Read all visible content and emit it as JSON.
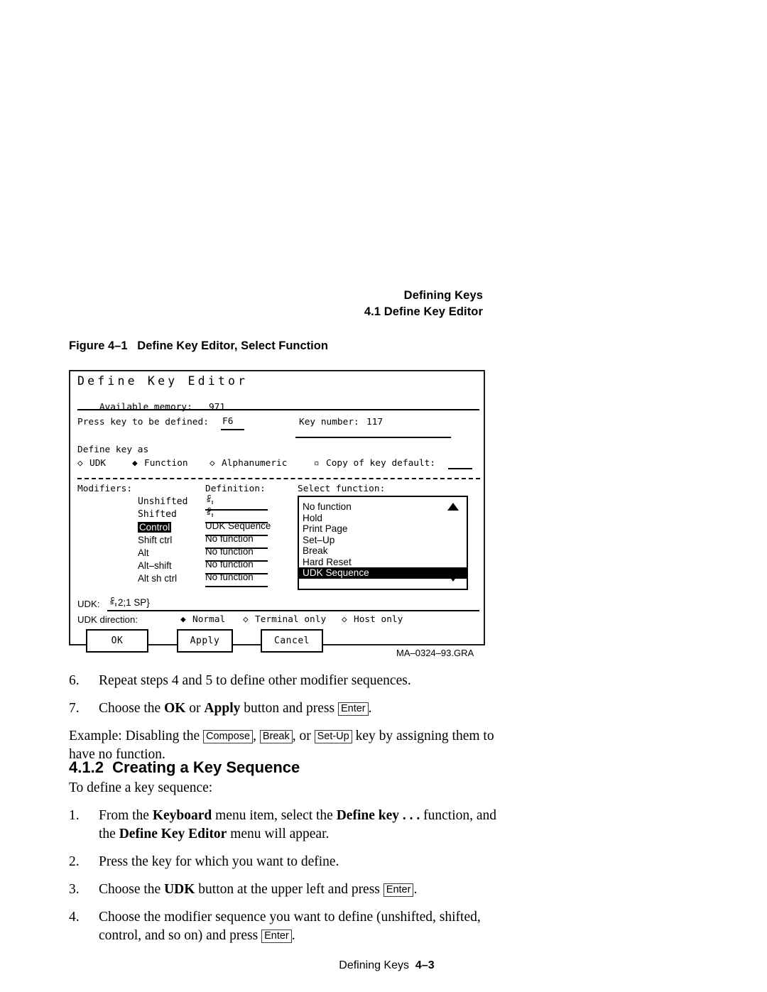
{
  "running_head": {
    "line1": "Defining Keys",
    "line2": "4.1 Define Key Editor"
  },
  "figure": {
    "caption": "Figure 4–1   Define Key Editor, Select Function",
    "graphic_id": "MA–0324–93.GRA",
    "dialog": {
      "title": "Define Key Editor",
      "available_memory_label": "Available memory:",
      "available_memory_value": "971",
      "press_key_label": "Press key to be defined:",
      "press_key_value": "F6",
      "key_number_label": "Key number:",
      "key_number_value": "117",
      "define_key_as_label": "Define key as",
      "define_key_as_options": [
        {
          "label": "UDK",
          "marker": "radio-empty",
          "selected": false
        },
        {
          "label": "Function",
          "marker": "radio-filled",
          "selected": true
        },
        {
          "label": "Alphanumeric",
          "marker": "radio-empty",
          "selected": false
        }
      ],
      "copy_of_key_default_label": "Copy of key default:",
      "copy_of_key_default_value": "",
      "modifiers_header": "Modifiers:",
      "definition_header": "Definition:",
      "select_function_header": "Select function:",
      "modifiers": [
        {
          "label": "Unshifted",
          "selected": false
        },
        {
          "label": "Shifted",
          "selected": false
        },
        {
          "label": "Control",
          "selected": true
        },
        {
          "label": "Shift ctrl",
          "selected": false
        },
        {
          "label": "Alt",
          "selected": false
        },
        {
          "label": "Alt–shift",
          "selected": false
        },
        {
          "label": "Alt sh ctrl",
          "selected": false
        }
      ],
      "definitions": [
        {
          "text": "",
          "csi": true
        },
        {
          "text": "",
          "csi": true
        },
        {
          "text": "UDK Sequence",
          "csi": false
        },
        {
          "text": "No function",
          "csi": false
        },
        {
          "text": "No function",
          "csi": false
        },
        {
          "text": "No function",
          "csi": false
        },
        {
          "text": "No function",
          "csi": false
        }
      ],
      "select_function_options": [
        {
          "label": "No function",
          "selected": false
        },
        {
          "label": "Hold",
          "selected": false
        },
        {
          "label": "Print Page",
          "selected": false
        },
        {
          "label": "Set–Up",
          "selected": false
        },
        {
          "label": "Break",
          "selected": false
        },
        {
          "label": "Hard Reset",
          "selected": false
        },
        {
          "label": "UDK  Sequence",
          "selected": true
        }
      ],
      "scroll_up_icon": "triangle-up-icon",
      "scroll_down_icon": "triangle-down-icon",
      "udk_label": "UDK:",
      "udk_value": "2;1 SP}",
      "udk_direction_label": "UDK direction:",
      "udk_direction_options": [
        {
          "label": "Normal",
          "marker": "radio-filled",
          "selected": true
        },
        {
          "label": "Terminal only",
          "marker": "radio-empty",
          "selected": false
        },
        {
          "label": "Host only",
          "marker": "radio-empty",
          "selected": false
        }
      ],
      "buttons": [
        {
          "label": "OK"
        },
        {
          "label": "Apply"
        },
        {
          "label": "Cancel"
        }
      ]
    }
  },
  "body": {
    "step6": {
      "num": "6.",
      "text": "Repeat steps 4 and 5 to define other modifier sequences."
    },
    "step7": {
      "num": "7.",
      "part1": "Choose the ",
      "bold1": "OK",
      "part2": " or ",
      "bold2": "Apply",
      "part3": " button and press ",
      "key1": "Enter",
      "part4": "."
    },
    "example": {
      "part1": "Example: Disabling the ",
      "key1": "Compose",
      "part2": ", ",
      "key2": "Break",
      "part3": ", or ",
      "key3": "Set-Up",
      "part4": " key by assigning them to have no function."
    },
    "section_heading": "4.1.2  Creating a Key Sequence",
    "intro": "To define a key sequence:",
    "step1": {
      "num": "1.",
      "part1": "From the ",
      "bold1": "Keyboard",
      "part2": " menu item, select the ",
      "bold2": "Define key . . .",
      "part3": " function, and the ",
      "bold3": "Define Key Editor",
      "part4": " menu will appear."
    },
    "step2": {
      "num": "2.",
      "text": "Press the key for which you want to define."
    },
    "step3": {
      "num": "3.",
      "part1": "Choose the ",
      "bold1": "UDK",
      "part2": " button at the upper left and press ",
      "key1": "Enter",
      "part3": "."
    },
    "step4": {
      "num": "4.",
      "part1": "Choose the modifier sequence you want to define (unshifted, shifted, control, and so on) and press ",
      "key1": "Enter",
      "part2": "."
    }
  },
  "footer": {
    "title": "Defining Keys",
    "page": "4–3"
  }
}
